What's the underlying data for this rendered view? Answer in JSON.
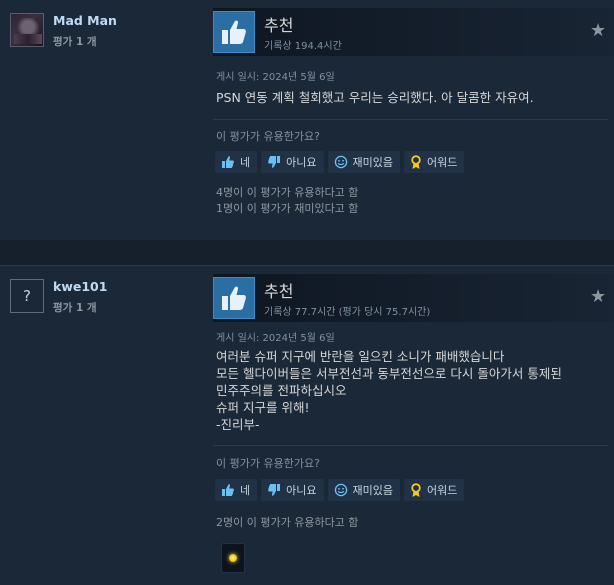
{
  "reviews": [
    {
      "author": {
        "name": "Mad Man",
        "review_count": "평가 1 개",
        "avatar": "dark-figure-avatar"
      },
      "recommendation": "추천",
      "hours": "기록상 194.4시간",
      "posted": "게시 일시: 2024년 5월 6일",
      "content": "PSN 연동 계획 철회했고 우리는 승리했다. 아 달콤한 자유여.",
      "helpful_question": "이 평가가 유용한가요?",
      "buttons": {
        "yes": "네",
        "no": "아니요",
        "funny": "재미있음",
        "award": "어워드"
      },
      "counts": [
        "4명이 이 평가가 유용하다고 함",
        "1명이 이 평가가 재미있다고 함"
      ]
    },
    {
      "author": {
        "name": "kwe101",
        "review_count": "평가 1 개",
        "avatar": "question-mark-avatar",
        "avatar_glyph": "?"
      },
      "recommendation": "추천",
      "hours": "기록상 77.7시간 (평가 당시 75.7시간)",
      "posted": "게시 일시: 2024년 5월 6일",
      "content": "여러분 슈퍼 지구에 반란을 일으킨 소니가 패배했습니다\n모든 헬다이버들은 서부전선과 동부전선으로 다시 돌아가서 통제된\n민주주의를 전파하십시오\n슈퍼 지구를 위해!\n-진리부-",
      "helpful_question": "이 평가가 유용한가요?",
      "buttons": {
        "yes": "네",
        "no": "아니요",
        "funny": "재미있음",
        "award": "어워드"
      },
      "counts": [
        "2명이 이 평가가 유용하다고 함"
      ]
    }
  ],
  "colors": {
    "background": "#1b2838",
    "accent_thumb": "#2a6ea3",
    "author_name": "#c1dbf4",
    "award_gold": "#f5c81f"
  },
  "icons": {
    "thumb": "thumbs-up-icon",
    "star": "star-icon",
    "award": "award-ribbon-icon"
  }
}
